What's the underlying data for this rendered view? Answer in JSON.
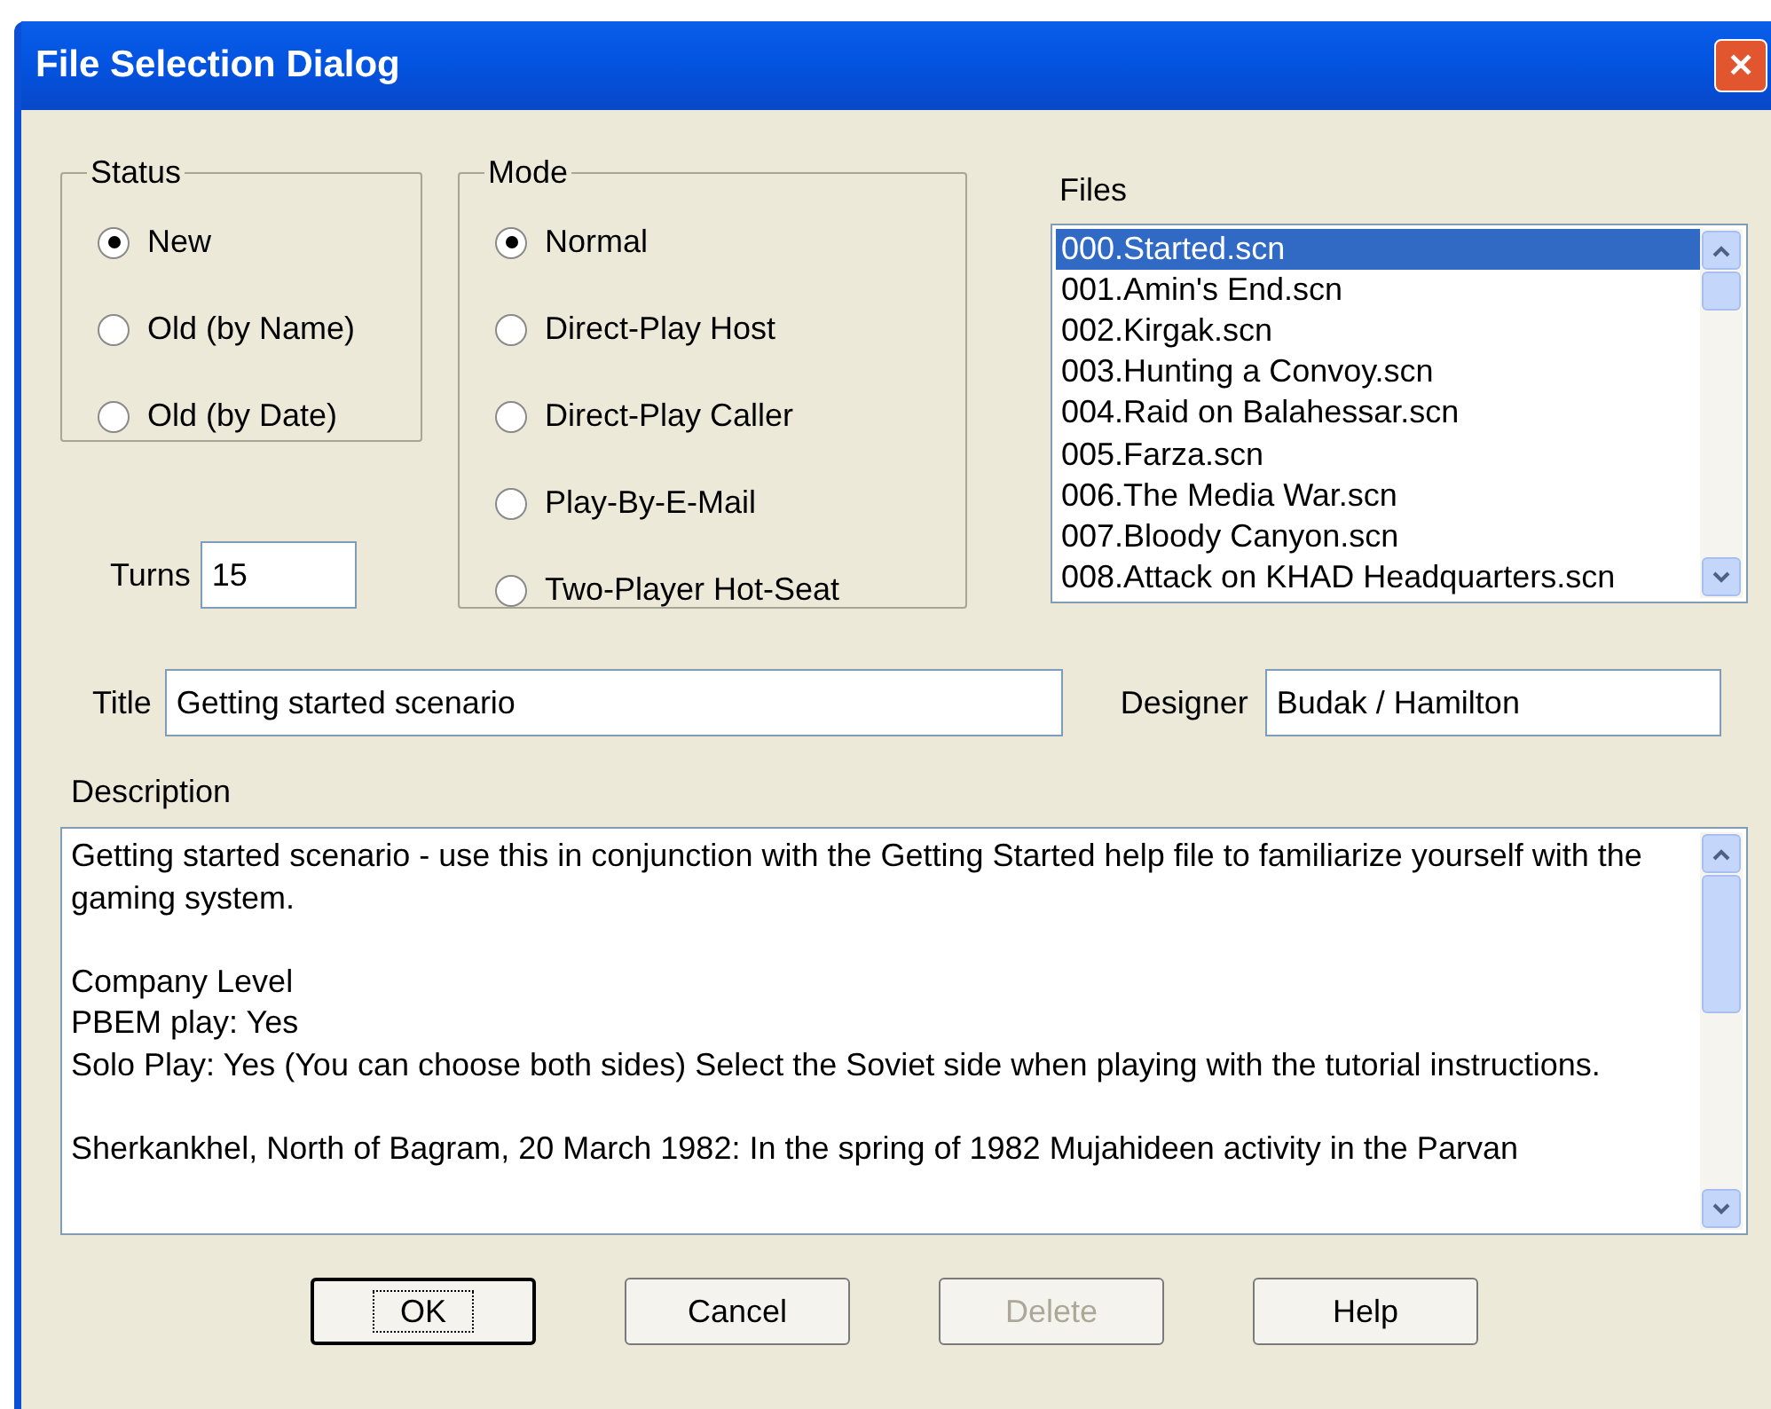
{
  "window": {
    "title": "File Selection Dialog",
    "close": "✕"
  },
  "status": {
    "label": "Status",
    "options": [
      {
        "label": "New",
        "selected": true
      },
      {
        "label": "Old (by Name)",
        "selected": false
      },
      {
        "label": "Old (by Date)",
        "selected": false
      }
    ]
  },
  "mode": {
    "label": "Mode",
    "options": [
      {
        "label": "Normal",
        "selected": true
      },
      {
        "label": "Direct-Play Host",
        "selected": false
      },
      {
        "label": "Direct-Play Caller",
        "selected": false
      },
      {
        "label": "Play-By-E-Mail",
        "selected": false
      },
      {
        "label": "Two-Player Hot-Seat",
        "selected": false
      }
    ]
  },
  "files": {
    "label": "Files",
    "items": [
      {
        "label": "000.Started.scn",
        "selected": true
      },
      {
        "label": "001.Amin's End.scn",
        "selected": false
      },
      {
        "label": "002.Kirgak.scn",
        "selected": false
      },
      {
        "label": "003.Hunting a Convoy.scn",
        "selected": false
      },
      {
        "label": "004.Raid on Balahessar.scn",
        "selected": false
      },
      {
        "label": "005.Farza.scn",
        "selected": false
      },
      {
        "label": "006.The Media War.scn",
        "selected": false
      },
      {
        "label": "007.Bloody Canyon.scn",
        "selected": false
      },
      {
        "label": "008.Attack on KHAD Headquarters.scn",
        "selected": false
      }
    ]
  },
  "turns": {
    "label": "Turns",
    "value": "15"
  },
  "title_field": {
    "label": "Title",
    "value": "Getting started scenario"
  },
  "designer": {
    "label": "Designer",
    "value": "Budak / Hamilton"
  },
  "description": {
    "label": "Description",
    "value": "Getting started scenario - use this in conjunction with the Getting Started help file to familiarize yourself with the gaming system.\n\nCompany Level\nPBEM play: Yes\nSolo Play: Yes (You can choose both sides) Select the Soviet side when playing with the tutorial instructions.\n\nSherkankhel, North of Bagram, 20 March 1982: In the spring of 1982 Mujahideen activity in the Parvan"
  },
  "buttons": [
    {
      "label": "OK",
      "default": true,
      "disabled": false
    },
    {
      "label": "Cancel",
      "default": false,
      "disabled": false
    },
    {
      "label": "Delete",
      "default": false,
      "disabled": true
    },
    {
      "label": "Help",
      "default": false,
      "disabled": false
    }
  ]
}
